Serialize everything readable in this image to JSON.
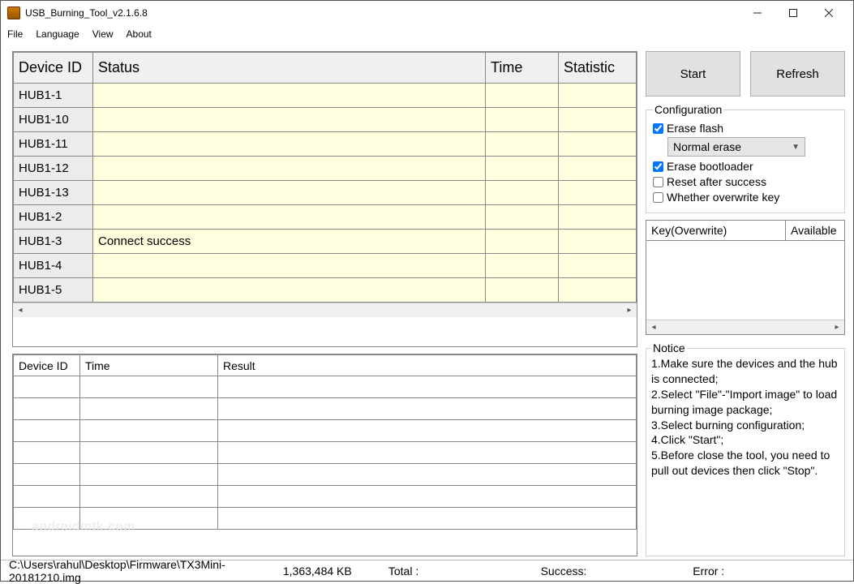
{
  "title": "USB_Burning_Tool_v2.1.6.8",
  "menu": {
    "file": "File",
    "language": "Language",
    "view": "View",
    "about": "About"
  },
  "mainTable": {
    "headers": {
      "deviceId": "Device ID",
      "status": "Status",
      "time": "Time",
      "statistic": "Statistic"
    },
    "rows": [
      {
        "id": "HUB1-1",
        "status": "",
        "time": "",
        "stat": ""
      },
      {
        "id": "HUB1-10",
        "status": "",
        "time": "",
        "stat": ""
      },
      {
        "id": "HUB1-11",
        "status": "",
        "time": "",
        "stat": ""
      },
      {
        "id": "HUB1-12",
        "status": "",
        "time": "",
        "stat": ""
      },
      {
        "id": "HUB1-13",
        "status": "",
        "time": "",
        "stat": ""
      },
      {
        "id": "HUB1-2",
        "status": "",
        "time": "",
        "stat": ""
      },
      {
        "id": "HUB1-3",
        "status": "Connect success",
        "time": "",
        "stat": ""
      },
      {
        "id": "HUB1-4",
        "status": "",
        "time": "",
        "stat": ""
      },
      {
        "id": "HUB1-5",
        "status": "",
        "time": "",
        "stat": ""
      }
    ]
  },
  "resultTable": {
    "headers": {
      "deviceId": "Device ID",
      "time": "Time",
      "result": "Result"
    }
  },
  "buttons": {
    "start": "Start",
    "refresh": "Refresh"
  },
  "config": {
    "legend": "Configuration",
    "eraseFlash": "Erase flash",
    "eraseMode": "Normal erase",
    "eraseBootloader": "Erase bootloader",
    "resetAfter": "Reset after success",
    "overwriteKey": "Whether overwrite key"
  },
  "keyBox": {
    "col1": "Key(Overwrite)",
    "col2": "Available"
  },
  "notice": {
    "legend": "Notice",
    "l1": "1.Make sure the devices and the hub is connected;",
    "l2": "2.Select \"File\"-\"Import image\" to load burning image package;",
    "l3": "3.Select burning configuration;",
    "l4": "4.Click \"Start\";",
    "l5": "5.Before close the tool, you need to pull out devices then click \"Stop\"."
  },
  "status": {
    "path": "C:\\Users\\rahul\\Desktop\\Firmware\\TX3Mini-20181210.img",
    "size": "1,363,484 KB",
    "total": "Total :",
    "success": "Success:",
    "error": "Error :"
  },
  "watermark": "androidmtk.com"
}
